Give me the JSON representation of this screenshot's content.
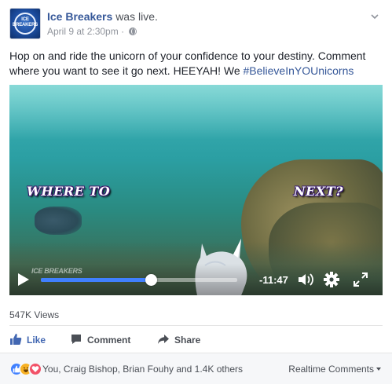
{
  "post": {
    "page_name": "Ice Breakers",
    "live_suffix": "was live.",
    "timestamp": "April 9 at 2:30pm",
    "separator": "·",
    "avatar_text": "ICE BREAKERS",
    "message_text": "Hop on and ride the unicorn of your confidence to your destiny. Comment where you want to see it go next. HEEYAH! We ",
    "hashtag": "#BelieveInYOUnicorns"
  },
  "video": {
    "overlay_left": "WHERE TO",
    "overlay_right": "NEXT?",
    "watermark": "ICE BREAKERS",
    "time_remaining": "-11:47",
    "progress": 0.56
  },
  "stats": {
    "views": "547K Views"
  },
  "actions": {
    "like": "Like",
    "comment": "Comment",
    "share": "Share"
  },
  "footer": {
    "reaction_names": "You, Craig Bishop, Brian Fouhy and 1.4K others",
    "realtime_label": "Realtime Comments"
  },
  "colors": {
    "link": "#365899",
    "like_blue": "#4267b2",
    "progress_blue": "#4080ff"
  }
}
